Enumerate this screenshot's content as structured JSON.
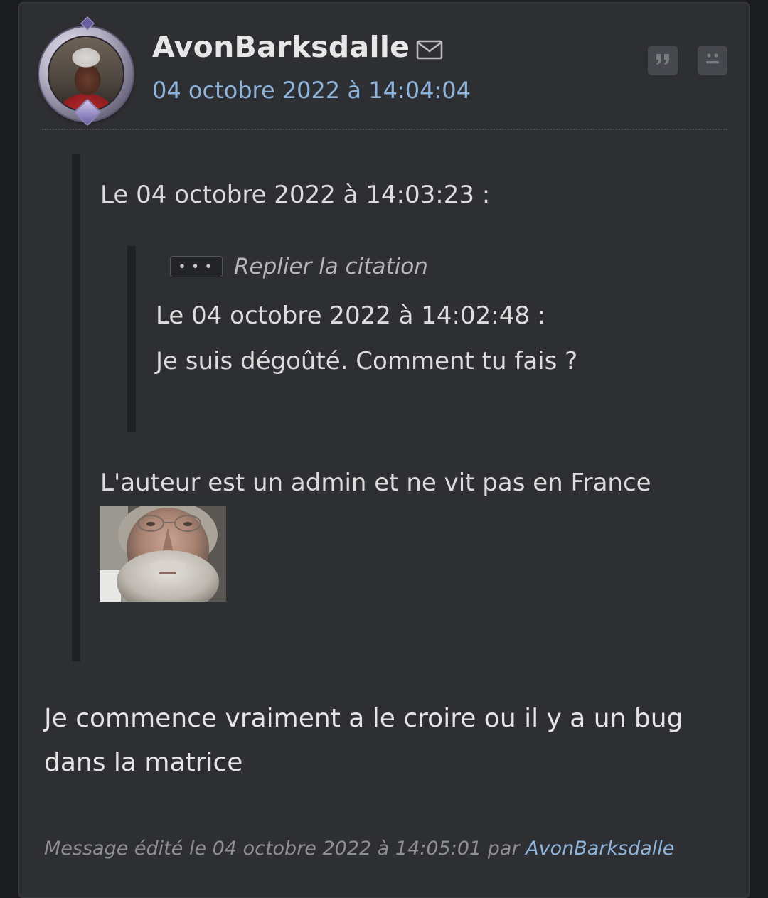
{
  "post": {
    "author": "AvonBarksdalle",
    "date": "04 octobre 2022 à 14:04:04",
    "icons": {
      "mail": "mail-icon",
      "quote": "quote-icon",
      "report": "sad-face-icon"
    }
  },
  "quote": {
    "header": "Le 04 octobre 2022 à 14:03:23 :",
    "nested": {
      "collapse_dots": "• • •",
      "collapse_label": "Replier la citation",
      "header": "Le 04 octobre 2022 à 14:02:48 :",
      "body": "Je suis dégoûté. Comment tu fais ?"
    },
    "body": "L'auteur est un admin et ne vit pas en France"
  },
  "reply": {
    "text": "Je commence vraiment a le croire ou il y a un bug dans la matrice"
  },
  "edited": {
    "prefix": "Message édité le 04 octobre 2022 à 14:05:01 par",
    "user": "AvonBarksdalle"
  },
  "colors": {
    "background": "#1b1c20",
    "panel": "#2e2f33",
    "link": "#8fb4dc",
    "text": "#dcdcdc",
    "muted": "#8e8f94"
  }
}
